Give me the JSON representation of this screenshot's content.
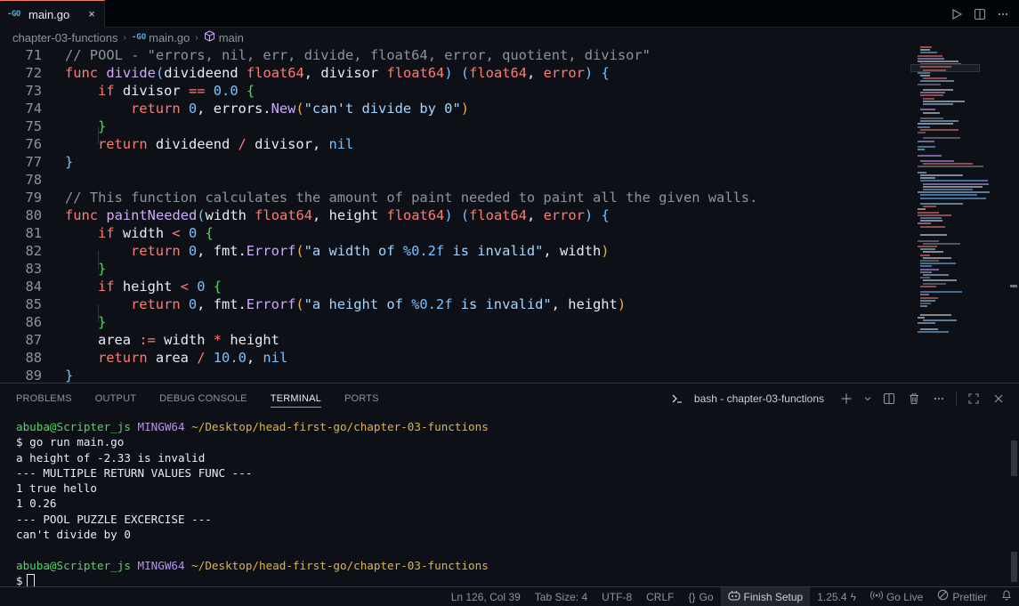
{
  "tab": {
    "badge": "-GO",
    "label": "main.go",
    "close": "×"
  },
  "breadcrumbs": {
    "folder": "chapter-03-functions",
    "file_badge": "-GO",
    "file": "main.go",
    "symbol": "main"
  },
  "editor": {
    "lines": [
      {
        "n": "71",
        "indent": 0,
        "tokens": [
          [
            "// POOL - \"errors, nil, err, divide, float64, error, quotient, divisor\"",
            "comment"
          ]
        ]
      },
      {
        "n": "72",
        "indent": 0,
        "tokens": [
          [
            "func ",
            "keyword"
          ],
          [
            "divide",
            "func"
          ],
          [
            "(",
            "p1"
          ],
          [
            "divideend ",
            "plain"
          ],
          [
            "float64",
            "type"
          ],
          [
            ", divisor ",
            "plain"
          ],
          [
            "float64",
            "type"
          ],
          [
            ") (",
            "p1"
          ],
          [
            "float64",
            "type"
          ],
          [
            ", ",
            "plain"
          ],
          [
            "error",
            "type"
          ],
          [
            ") {",
            "p1"
          ]
        ]
      },
      {
        "n": "73",
        "indent": 1,
        "tokens": [
          [
            "if ",
            "keyword"
          ],
          [
            "divisor ",
            "plain"
          ],
          [
            "==",
            "op"
          ],
          [
            " ",
            "plain"
          ],
          [
            "0.0",
            "num"
          ],
          [
            " {",
            "p2"
          ]
        ]
      },
      {
        "n": "74",
        "indent": 2,
        "tokens": [
          [
            "return ",
            "keyword"
          ],
          [
            "0",
            "num"
          ],
          [
            ", errors.",
            "plain"
          ],
          [
            "New",
            "func"
          ],
          [
            "(",
            "p3"
          ],
          [
            "\"can't divide by 0\"",
            "str"
          ],
          [
            ")",
            "p3"
          ]
        ]
      },
      {
        "n": "75",
        "indent": 1,
        "tokens": [
          [
            "}",
            "p2"
          ]
        ]
      },
      {
        "n": "76",
        "indent": 1,
        "tokens": [
          [
            "return ",
            "keyword"
          ],
          [
            "divideend ",
            "plain"
          ],
          [
            "/",
            "op"
          ],
          [
            " divisor, ",
            "plain"
          ],
          [
            "nil",
            "const"
          ]
        ]
      },
      {
        "n": "77",
        "indent": 0,
        "tokens": [
          [
            "}",
            "p1"
          ]
        ]
      },
      {
        "n": "78",
        "indent": 0,
        "tokens": []
      },
      {
        "n": "79",
        "indent": 0,
        "tokens": [
          [
            "// This function calculates the amount of paint needed to paint all the given walls.",
            "comment"
          ]
        ]
      },
      {
        "n": "80",
        "indent": 0,
        "tokens": [
          [
            "func ",
            "keyword"
          ],
          [
            "paintNeeded",
            "func"
          ],
          [
            "(",
            "p1"
          ],
          [
            "width ",
            "plain"
          ],
          [
            "float64",
            "type"
          ],
          [
            ", height ",
            "plain"
          ],
          [
            "float64",
            "type"
          ],
          [
            ") (",
            "p1"
          ],
          [
            "float64",
            "type"
          ],
          [
            ", ",
            "plain"
          ],
          [
            "error",
            "type"
          ],
          [
            ") {",
            "p1"
          ]
        ]
      },
      {
        "n": "81",
        "indent": 1,
        "tokens": [
          [
            "if ",
            "keyword"
          ],
          [
            "width ",
            "plain"
          ],
          [
            "<",
            "op"
          ],
          [
            " ",
            "plain"
          ],
          [
            "0",
            "num"
          ],
          [
            " {",
            "p2"
          ]
        ]
      },
      {
        "n": "82",
        "indent": 2,
        "tokens": [
          [
            "return ",
            "keyword"
          ],
          [
            "0",
            "num"
          ],
          [
            ", fmt.",
            "plain"
          ],
          [
            "Errorf",
            "func"
          ],
          [
            "(",
            "p3"
          ],
          [
            "\"a width of ",
            "str"
          ],
          [
            "%0.2f",
            "num"
          ],
          [
            " is invalid\"",
            "str"
          ],
          [
            ", width",
            "plain"
          ],
          [
            ")",
            "p3"
          ]
        ]
      },
      {
        "n": "83",
        "indent": 1,
        "tokens": [
          [
            "}",
            "p2"
          ]
        ]
      },
      {
        "n": "84",
        "indent": 1,
        "tokens": [
          [
            "if ",
            "keyword"
          ],
          [
            "height ",
            "plain"
          ],
          [
            "<",
            "op"
          ],
          [
            " ",
            "plain"
          ],
          [
            "0",
            "num"
          ],
          [
            " {",
            "p2"
          ]
        ]
      },
      {
        "n": "85",
        "indent": 2,
        "tokens": [
          [
            "return ",
            "keyword"
          ],
          [
            "0",
            "num"
          ],
          [
            ", fmt.",
            "plain"
          ],
          [
            "Errorf",
            "func"
          ],
          [
            "(",
            "p3"
          ],
          [
            "\"a height of ",
            "str"
          ],
          [
            "%0.2f",
            "num"
          ],
          [
            " is invalid\"",
            "str"
          ],
          [
            ", height",
            "plain"
          ],
          [
            ")",
            "p3"
          ]
        ]
      },
      {
        "n": "86",
        "indent": 1,
        "tokens": [
          [
            "}",
            "p2"
          ]
        ]
      },
      {
        "n": "87",
        "indent": 1,
        "tokens": [
          [
            "area ",
            "plain"
          ],
          [
            ":=",
            "op"
          ],
          [
            " width ",
            "plain"
          ],
          [
            "*",
            "op"
          ],
          [
            " height",
            "plain"
          ]
        ]
      },
      {
        "n": "88",
        "indent": 1,
        "tokens": [
          [
            "return ",
            "keyword"
          ],
          [
            "area ",
            "plain"
          ],
          [
            "/",
            "op"
          ],
          [
            " ",
            "plain"
          ],
          [
            "10.0",
            "num"
          ],
          [
            ", ",
            "plain"
          ],
          [
            "nil",
            "const"
          ]
        ]
      },
      {
        "n": "89",
        "indent": 0,
        "tokens": [
          [
            "}",
            "p1"
          ]
        ]
      }
    ]
  },
  "panel": {
    "tabs": [
      {
        "label": "PROBLEMS",
        "active": false
      },
      {
        "label": "OUTPUT",
        "active": false
      },
      {
        "label": "DEBUG CONSOLE",
        "active": false
      },
      {
        "label": "TERMINAL",
        "active": true
      },
      {
        "label": "PORTS",
        "active": false
      }
    ],
    "terminal_name": "bash - chapter-03-functions"
  },
  "terminal": {
    "user": "abuba@Scripter_js",
    "system": "MINGW64",
    "path": "~/Desktop/head-first-go/chapter-03-functions",
    "command": "$ go run main.go",
    "output": [
      "a height of -2.33 is invalid",
      "--- MULTIPLE RETURN VALUES FUNC ---",
      "1 true hello",
      "1 0.26",
      "--- POOL PUZZLE EXCERCISE ---",
      "can't divide by 0"
    ],
    "prompt": "$"
  },
  "statusbar": {
    "position": "Ln 126, Col 39",
    "tab_size": "Tab Size: 4",
    "encoding": "UTF-8",
    "eol": "CRLF",
    "language": "Go",
    "finish_setup": "Finish Setup",
    "go_version": "1.25.4",
    "go_live": "Go Live",
    "prettier": "Prettier"
  },
  "colors": {
    "background": "#0d1117",
    "keyword": "#ff7b72",
    "function": "#d2a8ff",
    "number": "#79c0ff",
    "string": "#a5d6ff",
    "comment": "#8b949e",
    "terminal_user": "#56d364",
    "terminal_system": "#bc8cff",
    "terminal_path": "#e3b341"
  }
}
